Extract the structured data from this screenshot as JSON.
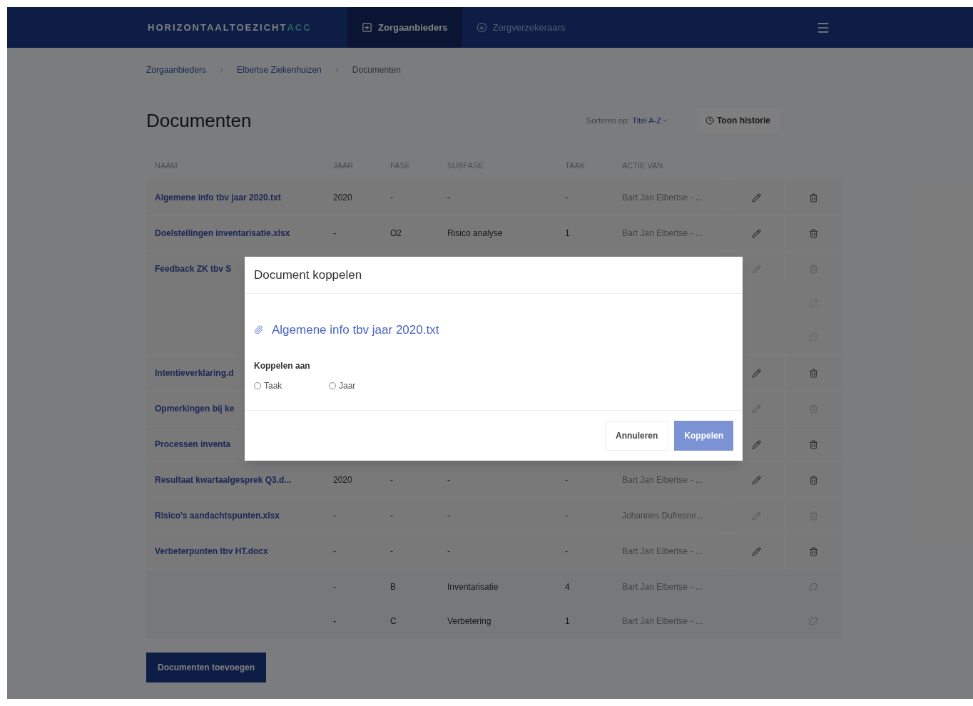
{
  "nav": {
    "logo": "HORIZONTAALTOEZICHT",
    "logo_suffix": "ACC",
    "tabs": [
      {
        "label": "Zorgaanbieders",
        "selected": true
      },
      {
        "label": "Zorgverzekeraars",
        "selected": false
      }
    ]
  },
  "breadcrumb": [
    "Zorgaanbieders",
    "Elbertse Ziekenhuizen",
    "Documenten"
  ],
  "title": "Documenten",
  "sort": {
    "label": "Sorteren op:",
    "value": "Titel A-Z"
  },
  "history_button": "Toon historie",
  "table": {
    "columns": [
      "NAAM",
      "JAAR",
      "FASE",
      "SUBFASE",
      "TAAK",
      "ACTIE VAN"
    ],
    "rows": [
      {
        "kind": "document",
        "name": "Algemene info tbv jaar 2020.txt",
        "jaar": "2020",
        "fase": "-",
        "subfase": "-",
        "taak": "-",
        "actie": "Bart Jan Elbertse - ...",
        "editable": true
      },
      {
        "kind": "document",
        "name": "Doelstellingen inventarisatie.xlsx",
        "jaar": "-",
        "fase": "O2",
        "subfase": "Risico analyse",
        "taak": "1",
        "actie": "Bart Jan Elbertse - ...",
        "editable": true
      },
      {
        "kind": "covered",
        "name": "Feedback ZK tbv S",
        "editable": false,
        "subrows": [
          {
            "editable": false
          },
          {
            "editable": false
          }
        ]
      },
      {
        "kind": "covered",
        "name": "Intentieverklaring.d",
        "editable": true
      },
      {
        "kind": "covered",
        "name": "Opmerkingen bij ke",
        "editable": false
      },
      {
        "kind": "covered",
        "name": "Processen inventa",
        "editable": true
      },
      {
        "kind": "document",
        "name": "Resultaat kwartaalgesprek Q3.d...",
        "jaar": "2020",
        "fase": "-",
        "subfase": "-",
        "taak": "-",
        "actie": "Bart Jan Elbertse - ...",
        "editable": true
      },
      {
        "kind": "document",
        "name": "Risico's aandachtspunten.xlsx",
        "jaar": "-",
        "fase": "-",
        "subfase": "-",
        "taak": "-",
        "actie": "Johannes Dufresne...",
        "editable": false
      },
      {
        "kind": "document",
        "name": "Verbeterpunten tbv HT.docx",
        "jaar": "-",
        "fase": "-",
        "subfase": "-",
        "taak": "-",
        "actie": "Bart Jan Elbertse - ...",
        "editable": true
      },
      {
        "kind": "link",
        "jaar": "-",
        "fase": "B",
        "subfase": "Inventarisatie",
        "taak": "4",
        "actie": "Bart Jan Elbertse - ..."
      },
      {
        "kind": "link",
        "jaar": "-",
        "fase": "C",
        "subfase": "Verbetering",
        "taak": "1",
        "actie": "Bart Jan Elbertse - ..."
      }
    ]
  },
  "add_button": "Documenten toevoegen",
  "modal": {
    "title": "Document koppelen",
    "file": "Algemene info tbv jaar 2020.txt",
    "link_label": "Koppelen aan",
    "options": [
      {
        "label": "Taak",
        "selected": false
      },
      {
        "label": "Jaar",
        "selected": false
      }
    ],
    "cancel": "Annuleren",
    "confirm": "Koppelen"
  }
}
